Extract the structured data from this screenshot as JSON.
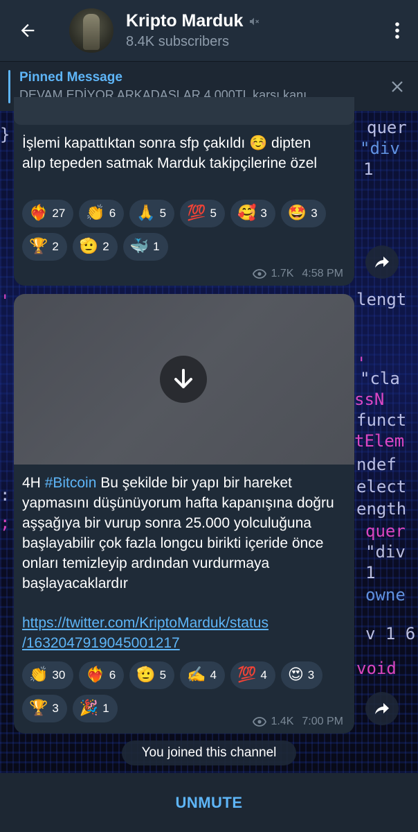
{
  "header": {
    "title": "Kripto Marduk",
    "subscribers": "8.4K subscribers",
    "back_icon": "arrow-left-icon",
    "muted_icon": "speaker-muted-icon",
    "menu_icon": "more-vertical-icon"
  },
  "pinned": {
    "label": "Pinned Message",
    "text": "DEVAM EDİYOR ARKADAŞLAR   4.000TL karşı kanı..."
  },
  "messages": [
    {
      "text": "İşlemi kapattıktan sonra sfp çakıldı ☺️ dipten alıp tepeden satmak Marduk takipçilerine özel",
      "reactions": [
        {
          "emoji": "❤️‍🔥",
          "count": "27"
        },
        {
          "emoji": "👏",
          "count": "6"
        },
        {
          "emoji": "🙏",
          "count": "5"
        },
        {
          "emoji": "💯",
          "count": "5"
        },
        {
          "emoji": "🥰",
          "count": "3"
        },
        {
          "emoji": "🤩",
          "count": "3"
        },
        {
          "emoji": "🏆",
          "count": "2"
        },
        {
          "emoji": "🫡",
          "count": "2"
        },
        {
          "emoji": "🐳",
          "count": "1"
        }
      ],
      "views": "1.7K",
      "time": "4:58 PM"
    },
    {
      "hashtag": "#Bitcoin",
      "prefix": "4H ",
      "text": " Bu şekilde bir yapı bir hareket yapmasını düşünüyorum hafta kapanışına doğru aşşağıya bir vurup sonra 25.000 yolculuğuna başlayabilir çok fazla longcu birikti içeride önce onları temizleyip ardından vurdurmaya başlayacaklardır",
      "url_line1": "https://twitter.com/KriptoMarduk/status",
      "url_line2": "/1632047919045001217",
      "reactions": [
        {
          "emoji": "👏",
          "count": "30"
        },
        {
          "emoji": "❤️‍🔥",
          "count": "6"
        },
        {
          "emoji": "🫡",
          "count": "5"
        },
        {
          "emoji": "✍️",
          "count": "4"
        },
        {
          "emoji": "💯",
          "count": "4"
        },
        {
          "emoji": "😍",
          "count": "3"
        },
        {
          "emoji": "🏆",
          "count": "3"
        },
        {
          "emoji": "🎉",
          "count": "1"
        }
      ],
      "views": "1.4K",
      "time": "7:00 PM"
    }
  ],
  "service_message": "You joined this channel",
  "bottom": {
    "action_label": "UNMUTE"
  },
  "colors": {
    "accent": "#5eb5f7",
    "bubble": "#1f2b38",
    "header": "#212d3b"
  }
}
